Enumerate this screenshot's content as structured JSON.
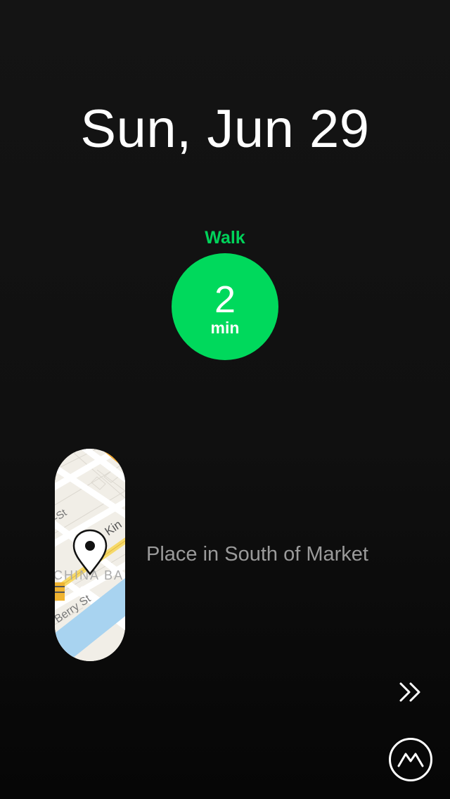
{
  "header": {
    "date": "Sun, Jun 29"
  },
  "activity": {
    "type_label": "Walk",
    "duration_value": "2",
    "duration_unit": "min",
    "accent_color": "#00d95c"
  },
  "place": {
    "name": "Place in South of Market",
    "map_labels": {
      "street_1": "-St",
      "street_2": "Kin",
      "district": "CHINA BA",
      "street_3": "Berry St"
    }
  },
  "icons": {
    "forward": "double-chevron-right-icon",
    "logo": "moves-logo-icon",
    "pin": "map-pin-icon"
  }
}
